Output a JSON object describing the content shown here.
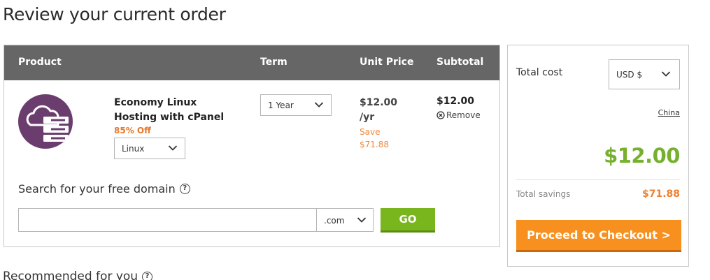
{
  "page": {
    "title": "Review your current order"
  },
  "table": {
    "headers": {
      "product": "Product",
      "term": "Term",
      "unit_price": "Unit Price",
      "subtotal": "Subtotal"
    }
  },
  "item": {
    "icon": "cloud-server-icon",
    "name": "Economy Linux Hosting with cPanel",
    "discount": "85% Off",
    "os_selected": "Linux",
    "term_selected": "1 Year",
    "unit_price_line1": "$12.00",
    "unit_price_line2": "/yr",
    "save_label": "Save",
    "save_amount": "$71.88",
    "subtotal": "$12.00",
    "remove_label": "Remove"
  },
  "domain_search": {
    "label": "Search for your free domain",
    "input_value": "",
    "tld_selected": ".com",
    "go_label": "GO"
  },
  "summary": {
    "total_label": "Total cost",
    "currency_selected": "USD $",
    "country_link": "China",
    "total_amount": "$12.00",
    "savings_label": "Total savings",
    "savings_amount": "$71.88",
    "checkout_label": "Proceed to Checkout >"
  },
  "recommended": {
    "label": "Recommended for you"
  },
  "colors": {
    "header_bg": "#666666",
    "accent_green": "#77b02e",
    "accent_orange": "#f7901e",
    "icon_purple": "#6b3d6e"
  }
}
